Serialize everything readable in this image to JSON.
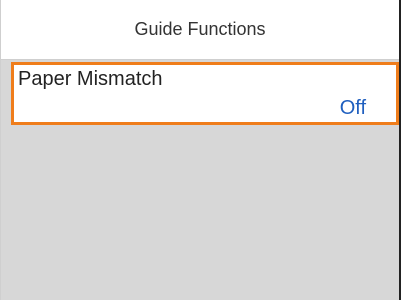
{
  "header": {
    "title": "Guide Functions"
  },
  "settings": {
    "items": [
      {
        "label": "Paper Mismatch",
        "value": "Off"
      }
    ]
  },
  "colors": {
    "selection_border": "#ef7d1b",
    "value_text": "#1f5fbf",
    "background": "#d7d7d7"
  }
}
